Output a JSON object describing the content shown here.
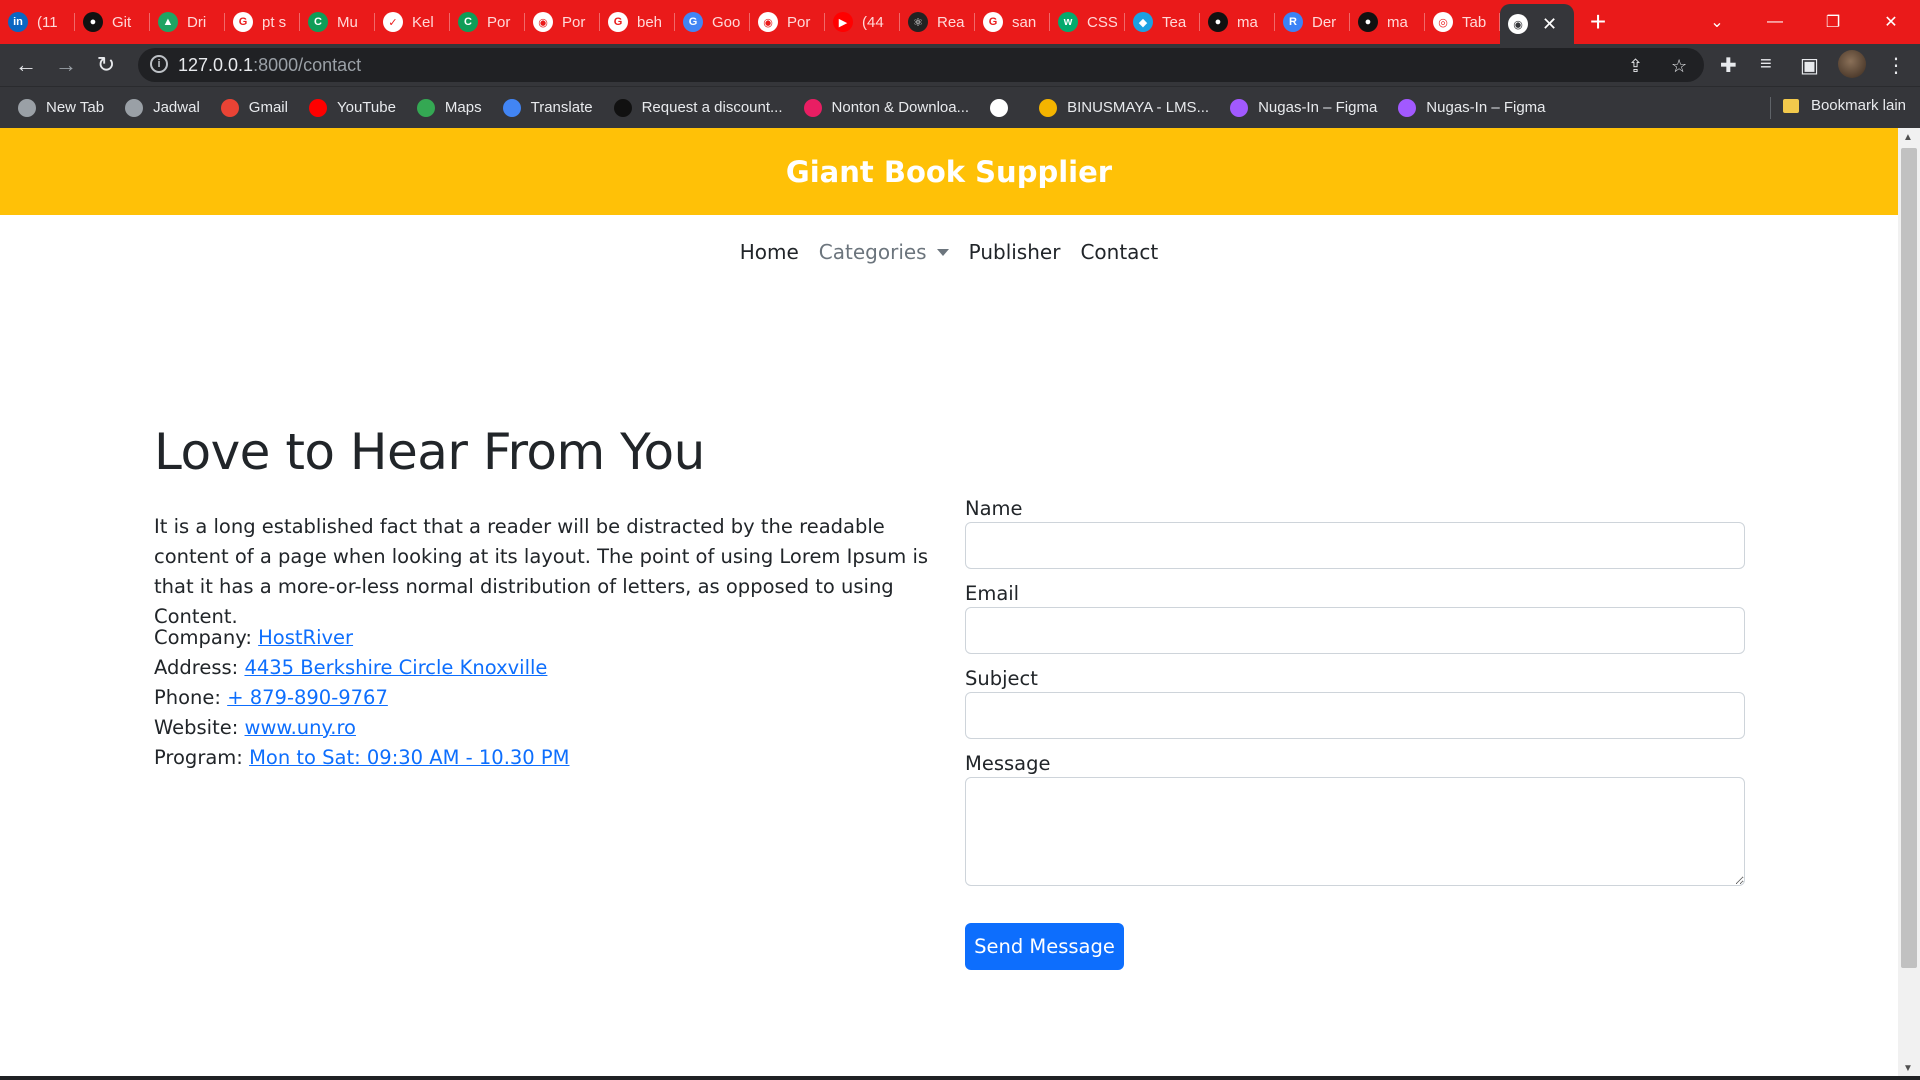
{
  "browser": {
    "tabs": [
      {
        "title": "(11",
        "icon": "linkedin-icon",
        "color": "#0a66c2",
        "glyph": "in"
      },
      {
        "title": "Git",
        "icon": "github-icon",
        "color": "#111111",
        "glyph": "●"
      },
      {
        "title": "Dri",
        "icon": "drive-icon",
        "color": "#1fa463",
        "glyph": "▲"
      },
      {
        "title": "pt s",
        "icon": "google-icon",
        "color": "#ffffff",
        "glyph": "G"
      },
      {
        "title": "Mu",
        "icon": "classroom-icon",
        "color": "#0f9d58",
        "glyph": "C"
      },
      {
        "title": "Kel",
        "icon": "form-icon",
        "color": "#ffffff",
        "glyph": "✓"
      },
      {
        "title": "Por",
        "icon": "classroom-icon",
        "color": "#0f9d58",
        "glyph": "C"
      },
      {
        "title": "Por",
        "icon": "globe-icon",
        "color": "#ffffff",
        "glyph": "◉"
      },
      {
        "title": "beh",
        "icon": "google-icon",
        "color": "#ffffff",
        "glyph": "G"
      },
      {
        "title": "Goo",
        "icon": "translate-icon",
        "color": "#4285f4",
        "glyph": "G"
      },
      {
        "title": "Por",
        "icon": "globe-icon",
        "color": "#ffffff",
        "glyph": "◉"
      },
      {
        "title": "(44",
        "icon": "youtube-icon",
        "color": "#ff0000",
        "glyph": "▶"
      },
      {
        "title": "Rea",
        "icon": "react-icon",
        "color": "#222222",
        "glyph": "⚛"
      },
      {
        "title": "san",
        "icon": "google-icon",
        "color": "#ffffff",
        "glyph": "G"
      },
      {
        "title": "CSS",
        "icon": "w3schools-icon",
        "color": "#04aa6d",
        "glyph": "w"
      },
      {
        "title": "Tea",
        "icon": "diamond-icon",
        "color": "#1ba1e2",
        "glyph": "◆"
      },
      {
        "title": "ma",
        "icon": "github-icon",
        "color": "#111111",
        "glyph": "●"
      },
      {
        "title": "Der",
        "icon": "r-icon",
        "color": "#3b82f6",
        "glyph": "R"
      },
      {
        "title": "ma",
        "icon": "github-icon",
        "color": "#111111",
        "glyph": "●"
      },
      {
        "title": "Tab",
        "icon": "chrome-icon",
        "color": "#ffffff",
        "glyph": "◎"
      }
    ],
    "active_tab": {
      "icon": "globe-icon",
      "close": "✕"
    },
    "new_tab": "+",
    "window_controls": {
      "dropdown": "⌄",
      "minimize": "—",
      "restore": "❐",
      "close": "✕"
    },
    "address": {
      "host": "127.0.0.1",
      "path": ":8000/contact"
    },
    "bookmarks": [
      {
        "label": "New Tab",
        "icon": "globe-icon",
        "color": "#9aa0a6"
      },
      {
        "label": "Jadwal",
        "icon": "globe-icon",
        "color": "#9aa0a6"
      },
      {
        "label": "Gmail",
        "icon": "gmail-icon",
        "color": "#ea4335"
      },
      {
        "label": "YouTube",
        "icon": "youtube-icon",
        "color": "#ff0000"
      },
      {
        "label": "Maps",
        "icon": "maps-icon",
        "color": "#34a853"
      },
      {
        "label": "Translate",
        "icon": "translate-icon",
        "color": "#4285f4"
      },
      {
        "label": "Request a discount...",
        "icon": "github-icon",
        "color": "#111111"
      },
      {
        "label": "Nonton & Downloa...",
        "icon": "film-icon",
        "color": "#e91e63"
      },
      {
        "label": "",
        "icon": "google-icon",
        "color": "#ffffff"
      },
      {
        "label": "BINUSMAYA - LMS...",
        "icon": "binus-icon",
        "color": "#f4b400"
      },
      {
        "label": "Nugas-In – Figma",
        "icon": "figma-icon",
        "color": "#a259ff"
      },
      {
        "label": "Nugas-In – Figma",
        "icon": "figma-icon",
        "color": "#a259ff"
      }
    ],
    "other_bookmarks": "Bookmark lain"
  },
  "site": {
    "title": "Giant Book Supplier",
    "header_color": "#ffc107",
    "nav": {
      "home": "Home",
      "categories": "Categories",
      "publisher": "Publisher",
      "contact": "Contact"
    }
  },
  "contact": {
    "heading": "Love to Hear From You",
    "intro": "It is a long established fact that a reader will be distracted by the readable content of a page when looking at its layout. The point of using Lorem Ipsum is that it has a more-or-less normal distribution of letters, as opposed to using Content.",
    "details": [
      {
        "label": "Company:",
        "value": "HostRiver"
      },
      {
        "label": "Address:",
        "value": "4435 Berkshire Circle Knoxville"
      },
      {
        "label": "Phone:",
        "value": "+ 879-890-9767"
      },
      {
        "label": "Website:",
        "value": "www.uny.ro"
      },
      {
        "label": "Program:",
        "value": "Mon to Sat: 09:30 AM - 10.30 PM"
      }
    ],
    "form": {
      "name_label": "Name",
      "name_value": "",
      "email_label": "Email",
      "email_value": "",
      "subject_label": "Subject",
      "subject_value": "",
      "message_label": "Message",
      "message_value": "",
      "submit_label": "Send Message"
    }
  },
  "colors": {
    "link": "#0d6efd",
    "primary_button": "#0d6efd",
    "tab_strip": "#ea1a1a",
    "toolbar": "#35363a"
  }
}
